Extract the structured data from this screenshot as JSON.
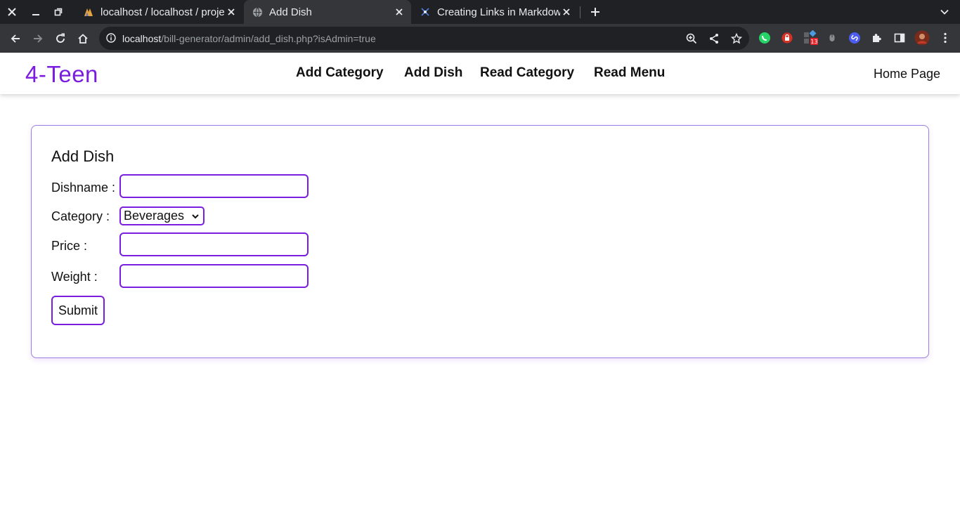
{
  "browser": {
    "window_controls": [
      "close",
      "minimize",
      "restore"
    ],
    "tabs": [
      {
        "title": "localhost / localhost / proje",
        "icon": "phpmyadmin-icon",
        "active": false
      },
      {
        "title": "Add Dish",
        "icon": "globe-icon",
        "active": true
      },
      {
        "title": "Creating Links in Markdown",
        "icon": "markdown-guide-icon",
        "active": false
      }
    ],
    "address": {
      "host": "localhost",
      "path": "/bill-generator/admin/add_dish.php?isAdmin=true"
    },
    "extensions": [
      "whatsapp-icon",
      "lock-extension-icon",
      "extension-badge-icon",
      "mouse-extension-icon",
      "shazam-icon",
      "puzzle-icon",
      "side-panel-icon",
      "profile-avatar-icon",
      "menu-icon"
    ],
    "badge_count": "13"
  },
  "navbar": {
    "brand": "4-Teen",
    "links": [
      "Add Category",
      "Add Dish",
      "Read Category",
      "Read Menu"
    ],
    "home": "Home Page"
  },
  "form": {
    "title": "Add Dish",
    "fields": [
      {
        "label": "Dishname :",
        "value": "",
        "type": "text"
      },
      {
        "label": "Category :",
        "value": "Beverages",
        "type": "select"
      },
      {
        "label": "Price :",
        "value": "",
        "type": "text"
      },
      {
        "label": "Weight :",
        "value": "",
        "type": "text"
      }
    ],
    "submit_label": "Submit"
  },
  "colors": {
    "accent": "#7a1de0",
    "card_border": "#9a7de6",
    "chrome_dark": "#202124",
    "chrome_mid": "#35363a"
  }
}
